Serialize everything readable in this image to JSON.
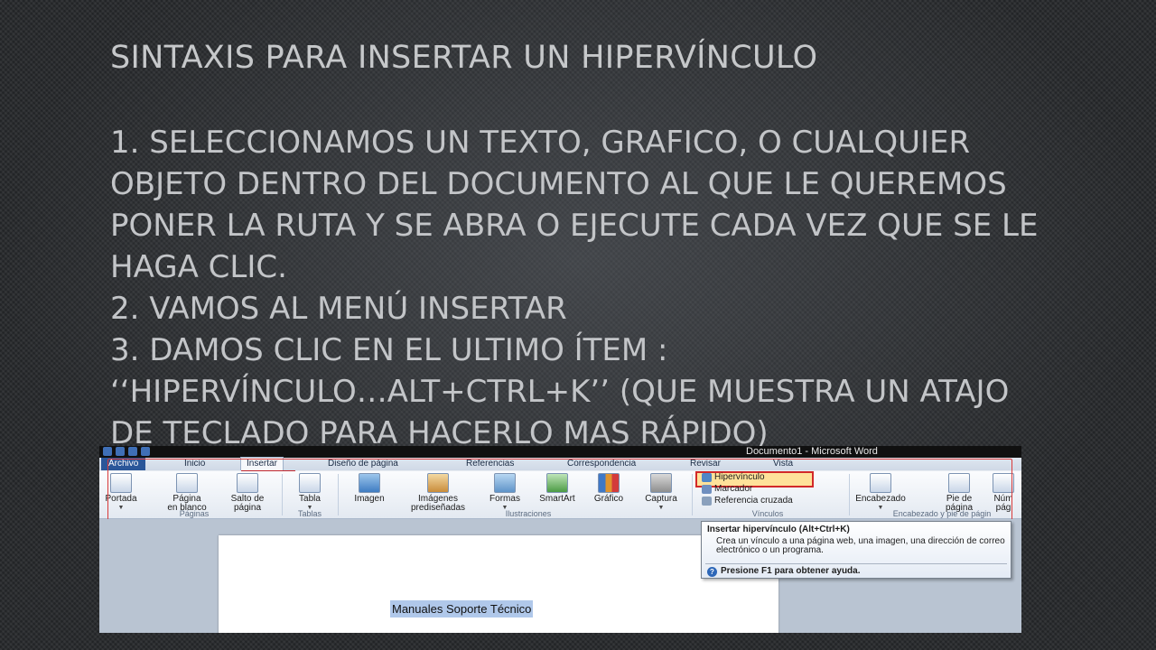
{
  "slide": {
    "title": "SINTAXIS PARA INSERTAR UN HIPERVÍNCULO",
    "lines": [
      "1. SELECCIONAMOS UN TEXTO, GRAFICO, O CUALQUIER",
      "OBJETO DENTRO DEL DOCUMENTO AL QUE LE QUEREMOS",
      "PONER LA RUTA Y SE ABRA O EJECUTE CADA VEZ QUE SE LE",
      "HAGA CLIC.",
      "2. VAMOS AL MENÚ INSERTAR",
      "3. DAMOS CLIC EN EL ULTIMO ÍTEM :",
      "‘‘HIPERVÍNCULO…ALT+CTRL+K’’ (QUE MUESTRA UN ATAJO",
      "DE TECLADO PARA HACERLO MAS RÁPIDO)"
    ]
  },
  "word": {
    "window_title": "Documento1 - Microsoft Word",
    "tabs": [
      "Archivo",
      "Inicio",
      "Insertar",
      "Diseño de página",
      "Referencias",
      "Correspondencia",
      "Revisar",
      "Vista"
    ],
    "active_tab": "Insertar",
    "ribbon": {
      "paginas": {
        "label": "Páginas",
        "portada": "Portada",
        "blank_1": "Página",
        "blank_2": "en blanco",
        "break_1": "Salto de",
        "break_2": "página"
      },
      "tablas": {
        "label": "Tablas",
        "tabla": "Tabla"
      },
      "ilustraciones": {
        "label": "Ilustraciones",
        "imagen": "Imagen",
        "pred_1": "Imágenes",
        "pred_2": "prediseñadas",
        "formas": "Formas",
        "smartart": "SmartArt",
        "grafico": "Gráfico",
        "captura": "Captura"
      },
      "vinculos": {
        "label": "Vínculos",
        "hipervinculo": "Hipervínculo",
        "marcador": "Marcador",
        "referencia": "Referencia cruzada"
      },
      "encabezado": {
        "label": "Encabezado y pie de págin",
        "encabezado": "Encabezado",
        "pie_1": "Pie de",
        "pie_2": "página",
        "num_1": "Núm",
        "num_2": "pág"
      }
    },
    "tooltip": {
      "title": "Insertar hipervínculo (Alt+Ctrl+K)",
      "body": "Crea un vínculo a una página web, una imagen, una dirección de correo electrónico o un programa.",
      "help": "Presione F1 para obtener ayuda."
    },
    "document_text": "Manuales Soporte Técnico"
  }
}
